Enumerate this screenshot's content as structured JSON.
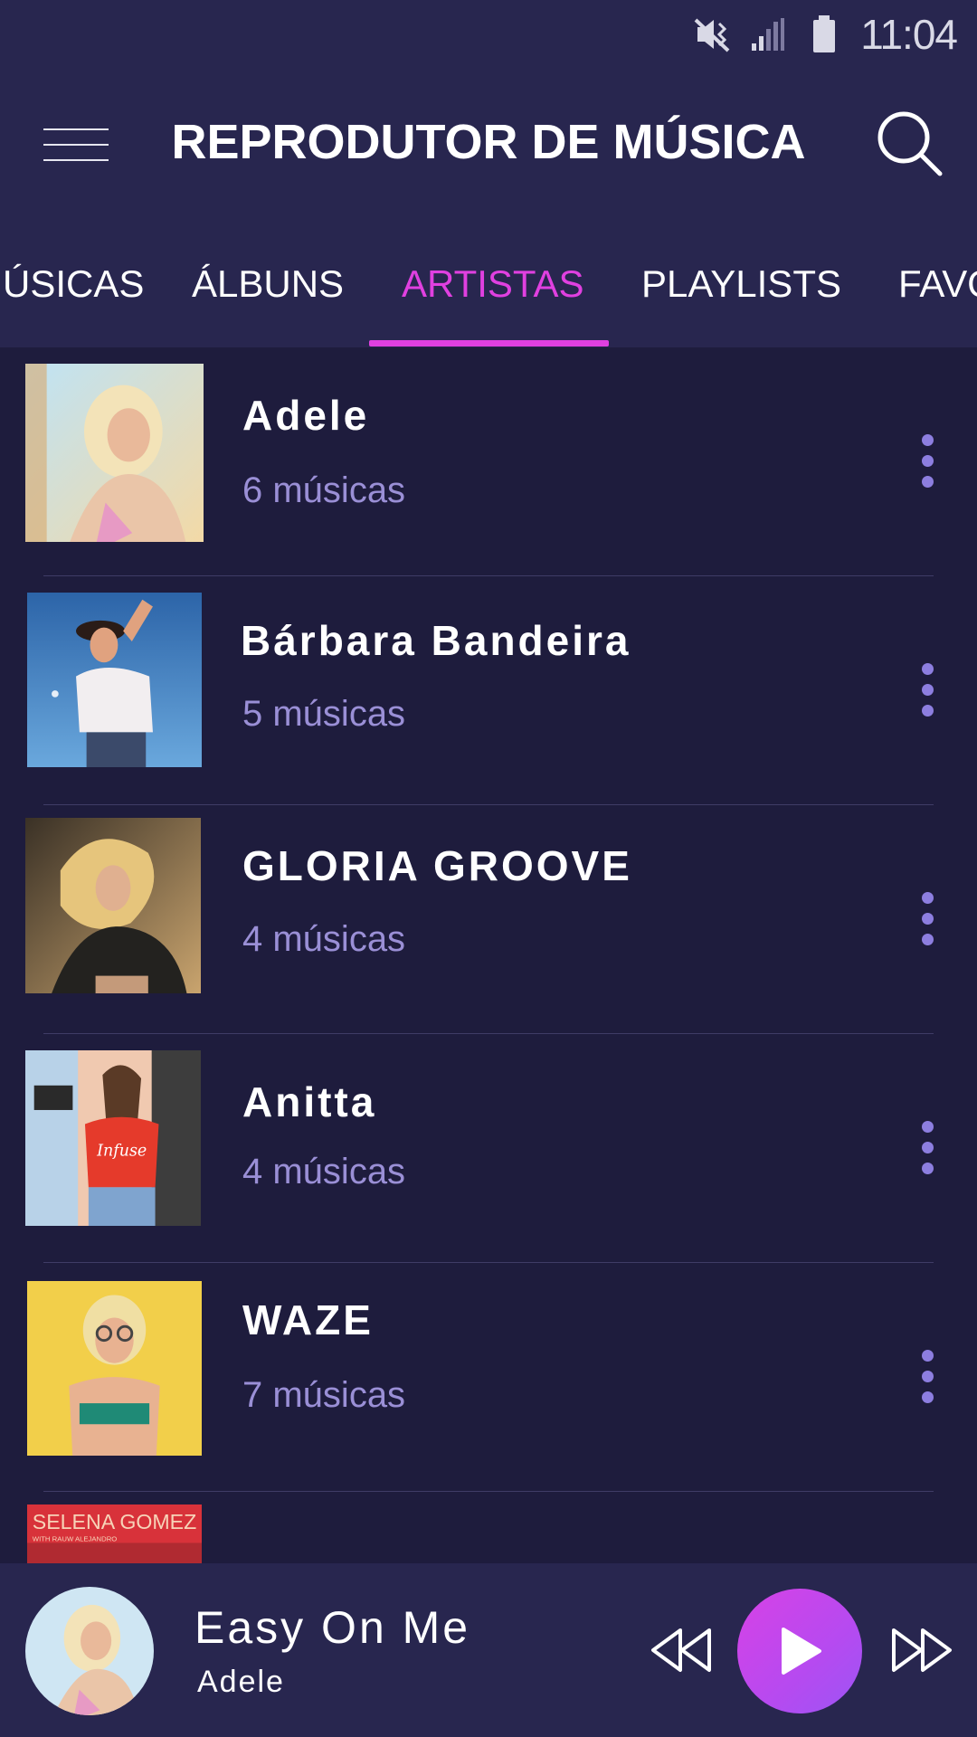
{
  "status_bar": {
    "time": "11:04",
    "icons": [
      "mute-vibrate-icon",
      "signal-icon",
      "battery-icon"
    ]
  },
  "header": {
    "title": "REPRODUTOR DE MÚSICA",
    "menu_icon": "hamburger-menu-icon",
    "search_icon": "search-icon"
  },
  "tabs": [
    {
      "label": "MÚSICAS",
      "active": false
    },
    {
      "label": "ÁLBUNS",
      "active": false
    },
    {
      "label": "ARTISTAS",
      "active": true
    },
    {
      "label": "PLAYLISTS",
      "active": false
    },
    {
      "label": "FAVORITOS",
      "active": false
    }
  ],
  "artists": [
    {
      "name": "Adele",
      "count": "6 músicas"
    },
    {
      "name": "Bárbara Bandeira",
      "count": "5 músicas"
    },
    {
      "name": "GLORIA GROOVE",
      "count": "4 músicas"
    },
    {
      "name": "Anitta",
      "count": "4 músicas"
    },
    {
      "name": "WAZE",
      "count": "7 músicas"
    },
    {
      "name": "",
      "count": "",
      "cover_text": "SELENA GOMEZ",
      "cover_subtext": "WITH RAUW ALEJANDRO"
    }
  ],
  "now_playing": {
    "title": "Easy On Me",
    "artist": "Adele"
  },
  "colors": {
    "background": "#1e1c3d",
    "header": "#28264f",
    "accent": "#e040e0",
    "secondary_text": "#9a8fd6"
  }
}
